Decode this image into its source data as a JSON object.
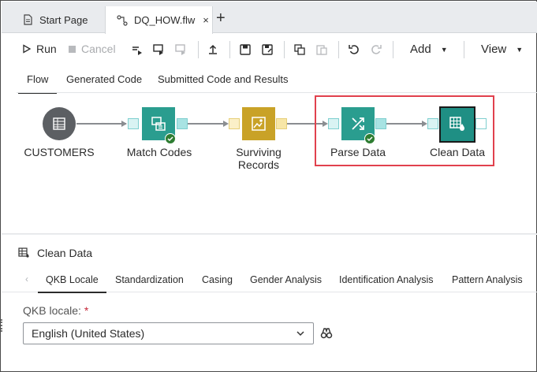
{
  "doc_tabs": [
    {
      "label": "Start Page",
      "icon": "document-icon"
    },
    {
      "label": "DQ_HOW.flw",
      "icon": "flow-icon",
      "active": true
    }
  ],
  "add_tab_label": "+",
  "close_glyph": "×",
  "toolbar": {
    "run_label": "Run",
    "cancel_label": "Cancel",
    "add_label": "Add",
    "view_label": "View",
    "caret": "▼"
  },
  "view_tabs": {
    "flow": "Flow",
    "generated": "Generated Code",
    "submitted": "Submitted Code and Results"
  },
  "nodes": {
    "customers": {
      "label": "CUSTOMERS",
      "color": "#5c5f63"
    },
    "match_codes": {
      "label": "Match Codes",
      "color": "#2a9d8f"
    },
    "surviving_records": {
      "label_line1": "Surviving",
      "label_line2": "Records",
      "color": "#c9a227"
    },
    "parse_data": {
      "label": "Parse Data",
      "color": "#2a9d8f"
    },
    "clean_data": {
      "label": "Clean Data",
      "color": "#1f8f84"
    }
  },
  "colors": {
    "accent_teal": "#2a9d8f",
    "highlight_red": "#e1414d",
    "success_green": "#2e7d32",
    "port_teal": "#a8e3e3",
    "port_gold": "#f7e6a6"
  },
  "properties": {
    "title": "Clean Data",
    "tabs": [
      "QKB Locale",
      "Standardization",
      "Casing",
      "Gender Analysis",
      "Identification Analysis",
      "Pattern Analysis"
    ],
    "tab_prev_glyph": "‹",
    "qkb_label": "QKB locale:",
    "required_mark": "*",
    "qkb_value": "English (United States)"
  }
}
